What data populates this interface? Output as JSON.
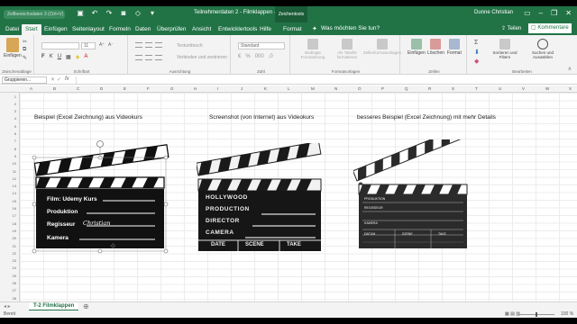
{
  "titlebar": {
    "search_placeholder": "Zellbereichsdaten 3 (Ctrl+V)",
    "doc_title": "Teilnehmerdaten 2 - Filmklappen  -  Excel",
    "tools_label": "Zeichentools",
    "user": "Dunne Christian"
  },
  "tabs": [
    "Datei",
    "Start",
    "Einfügen",
    "Seitenlayout",
    "Formeln",
    "Daten",
    "Überprüfen",
    "Ansicht",
    "Entwicklertools",
    "Hilfe",
    "Format"
  ],
  "active_tab": "Start",
  "tell_me": "Was möchten Sie tun?",
  "share_label": "Teilen",
  "comments_label": "Kommentare",
  "ribbon": {
    "clipboard": {
      "paste": "Einfügen",
      "label": "Zwischenablage"
    },
    "font": {
      "name": "",
      "size": "11",
      "label": "Schriftart",
      "bold": "F",
      "italic": "K",
      "underline": "U"
    },
    "alignment": {
      "wrap": "Textumbruch",
      "merge": "Verbinden und zentrieren",
      "label": "Ausrichtung"
    },
    "number": {
      "format": "Standard",
      "label": "Zahl"
    },
    "styles": {
      "conditional": "Bedingte Formatierung",
      "table": "Als Tabelle formatieren",
      "cell": "Zellenformatvorlagen",
      "label": "Formatvorlagen"
    },
    "cells": {
      "insert": "Einfügen",
      "delete": "Löschen",
      "format": "Format",
      "label": "Zellen"
    },
    "editing": {
      "sort": "Sortieren und Filtern",
      "find": "Suchen und Auswählen",
      "label": "Bearbeiten"
    }
  },
  "formula_bar": {
    "name_box": "Gruppieren...",
    "fx": "fx"
  },
  "columns": [
    "A",
    "B",
    "C",
    "D",
    "E",
    "F",
    "G",
    "H",
    "I",
    "J",
    "K",
    "L",
    "M",
    "N",
    "O",
    "P",
    "Q",
    "R",
    "S",
    "T",
    "U",
    "V",
    "W",
    "X"
  ],
  "rows": [
    "1",
    "2",
    "3",
    "4",
    "5",
    "6",
    "7",
    "8",
    "9",
    "10",
    "11",
    "12",
    "13",
    "14",
    "15",
    "16",
    "17",
    "18",
    "19",
    "20",
    "21",
    "22",
    "23",
    "24",
    "25",
    "26",
    "27",
    "28"
  ],
  "captions": {
    "left": "Beispiel (Excel Zeichnung) aus Videokurs",
    "middle": "Screenshot (von Internet) aus Videokurs",
    "right": "besseres Beispiel (Excel Zeichnung) mit mehr Details"
  },
  "clap1": {
    "film": "Film: Udemy Kurs",
    "produktion": "Produktion",
    "regisseur": "Regisseur",
    "regisseur_value": "Christian",
    "kamera": "Kamera"
  },
  "clap2": {
    "hollywood": "HOLLYWOOD",
    "production": "PRODUCTION",
    "director": "DIRECTOR",
    "camera": "CAMERA",
    "date": "DATE",
    "scene": "SCENE",
    "take": "TAKE"
  },
  "clap3": {
    "produktion": "PRODUKTION",
    "regisseur": "REGISSEUR",
    "kamera": "KAMERA",
    "datum": "DATUM",
    "szene": "SZENE",
    "take": "TAKE"
  },
  "sheet_tab": "T-2 Filmklappen",
  "status": "Bereit",
  "zoom_percent": "100 %",
  "colors": {
    "accent": "#217346",
    "accent_dark": "#1a5c37"
  }
}
